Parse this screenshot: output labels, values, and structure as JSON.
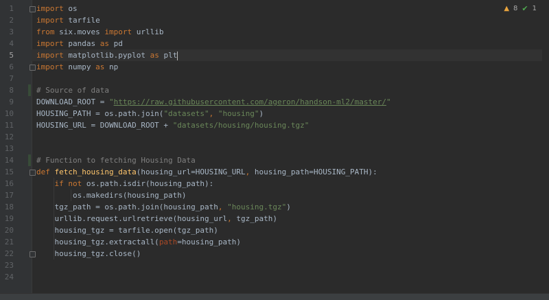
{
  "inspections": {
    "warnings": "8",
    "ok": "1"
  },
  "lines": [
    {
      "n": "1",
      "segs": [
        [
          "kw",
          "import"
        ],
        [
          "t",
          " os"
        ]
      ]
    },
    {
      "n": "2",
      "segs": [
        [
          "kw",
          "import"
        ],
        [
          "t",
          " tarfile"
        ]
      ]
    },
    {
      "n": "3",
      "segs": [
        [
          "kw",
          "from"
        ],
        [
          "t",
          " six.moves "
        ],
        [
          "kw",
          "import"
        ],
        [
          "t",
          " urllib"
        ]
      ]
    },
    {
      "n": "4",
      "segs": [
        [
          "kw",
          "import"
        ],
        [
          "t",
          " pandas "
        ],
        [
          "kw",
          "as"
        ],
        [
          "t",
          " pd"
        ]
      ]
    },
    {
      "n": "5",
      "segs": [
        [
          "kw",
          "import"
        ],
        [
          "t",
          " matplotlib.pyplot "
        ],
        [
          "kw",
          "as"
        ],
        [
          "t",
          " plt"
        ],
        [
          "caret",
          ""
        ]
      ],
      "current": true
    },
    {
      "n": "6",
      "segs": [
        [
          "kw",
          "import"
        ],
        [
          "t",
          " numpy "
        ],
        [
          "kw",
          "as"
        ],
        [
          "t",
          " np"
        ]
      ]
    },
    {
      "n": "7",
      "segs": []
    },
    {
      "n": "8",
      "segs": [
        [
          "cmt",
          "# Source of data"
        ]
      ]
    },
    {
      "n": "9",
      "segs": [
        [
          "t",
          "DOWNLOAD_ROOT = "
        ],
        [
          "str",
          "\""
        ],
        [
          "url",
          "https://raw.githubusercontent.com/ageron/handson-ml2/master/"
        ],
        [
          "str",
          "\""
        ]
      ]
    },
    {
      "n": "10",
      "segs": [
        [
          "t",
          "HOUSING_PATH = os.path.join("
        ],
        [
          "str",
          "\"datasets\""
        ],
        [
          "kw",
          ", "
        ],
        [
          "str",
          "\"housing\""
        ],
        [
          "t",
          ")"
        ]
      ]
    },
    {
      "n": "11",
      "segs": [
        [
          "t",
          "HOUSING_URL = DOWNLOAD_ROOT + "
        ],
        [
          "str",
          "\"datasets/housing/housing.tgz\""
        ]
      ]
    },
    {
      "n": "12",
      "segs": []
    },
    {
      "n": "13",
      "segs": []
    },
    {
      "n": "14",
      "segs": [
        [
          "cmt",
          "# Function to fetching Housing Data"
        ]
      ]
    },
    {
      "n": "15",
      "segs": [
        [
          "kw",
          "def "
        ],
        [
          "fn",
          "fetch_housing_data"
        ],
        [
          "t",
          "(housing_url=HOUSING_URL"
        ],
        [
          "kw",
          ", "
        ],
        [
          "t",
          "housing_path=HOUSING_PATH):"
        ]
      ]
    },
    {
      "n": "16",
      "segs": [
        [
          "t",
          "    "
        ],
        [
          "kw",
          "if not"
        ],
        [
          "t",
          " os.path.isdir(housing_path):"
        ]
      ]
    },
    {
      "n": "17",
      "segs": [
        [
          "t",
          "        os.makedirs(housing_path)"
        ]
      ]
    },
    {
      "n": "18",
      "segs": [
        [
          "t",
          "    tgz_path = os.path.join(housing_path"
        ],
        [
          "kw",
          ", "
        ],
        [
          "str",
          "\"housing.tgz\""
        ],
        [
          "t",
          ")"
        ]
      ]
    },
    {
      "n": "19",
      "segs": [
        [
          "t",
          "    urllib.request.urlretrieve(housing_url"
        ],
        [
          "kw",
          ", "
        ],
        [
          "t",
          "tgz_path)"
        ]
      ]
    },
    {
      "n": "20",
      "segs": [
        [
          "t",
          "    housing_tgz = tarfile.open(tgz_path)"
        ]
      ]
    },
    {
      "n": "21",
      "segs": [
        [
          "t",
          "    housing_tgz.extractall("
        ],
        [
          "param",
          "path"
        ],
        [
          "t",
          "=housing_path)"
        ]
      ]
    },
    {
      "n": "22",
      "segs": [
        [
          "t",
          "    housing_tgz.close()"
        ]
      ]
    },
    {
      "n": "23",
      "segs": []
    },
    {
      "n": "24",
      "segs": []
    }
  ]
}
